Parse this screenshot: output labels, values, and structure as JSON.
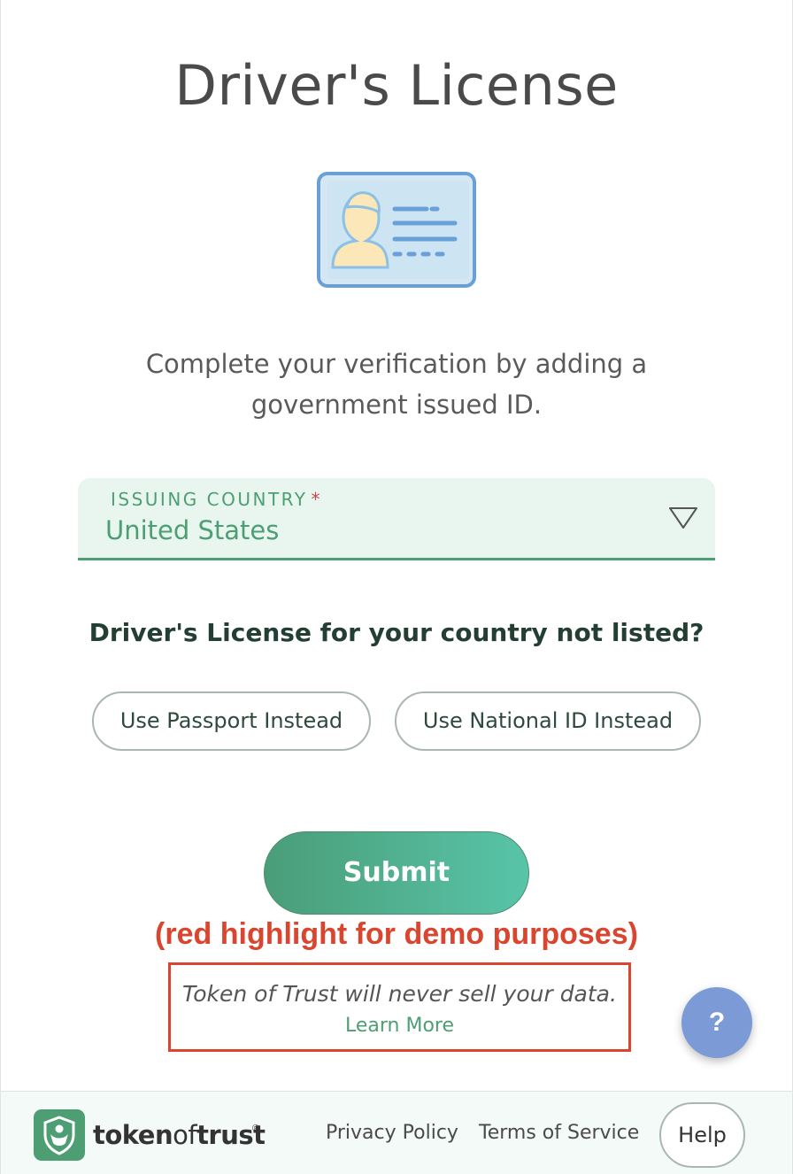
{
  "page": {
    "title": "Driver's License",
    "instructions": "Complete your verification by adding a government issued ID."
  },
  "country_select": {
    "label": "ISSUING COUNTRY",
    "required_marker": "*",
    "value": "United States"
  },
  "alternatives": {
    "question": "Driver's License for your country not listed?",
    "passport_label": "Use Passport Instead",
    "national_id_label": "Use National ID Instead"
  },
  "submit_label": "Submit",
  "demo_note": "(red highlight for demo purposes)",
  "privacy_notice": {
    "text": "Token of Trust will never sell your data.",
    "link": "Learn More"
  },
  "help_fab": "?",
  "footer": {
    "brand_prefix": "token",
    "brand_mid": "of",
    "brand_suffix": "trust",
    "brand_registered": "®",
    "privacy_policy": "Privacy Policy",
    "terms_of_service": "Terms of Service",
    "help": "Help"
  },
  "icons": {
    "id_card": "id-card-icon",
    "dropdown": "triangle-down-icon",
    "logo": "shield-person-icon"
  },
  "colors": {
    "accent_green": "#4e9e73",
    "submit_gradient_start": "#4a9d78",
    "submit_gradient_end": "#58c4a8",
    "highlight_red": "#d9452e",
    "help_fab_blue": "#7b9ad6",
    "select_bg": "#e8f6ef"
  }
}
